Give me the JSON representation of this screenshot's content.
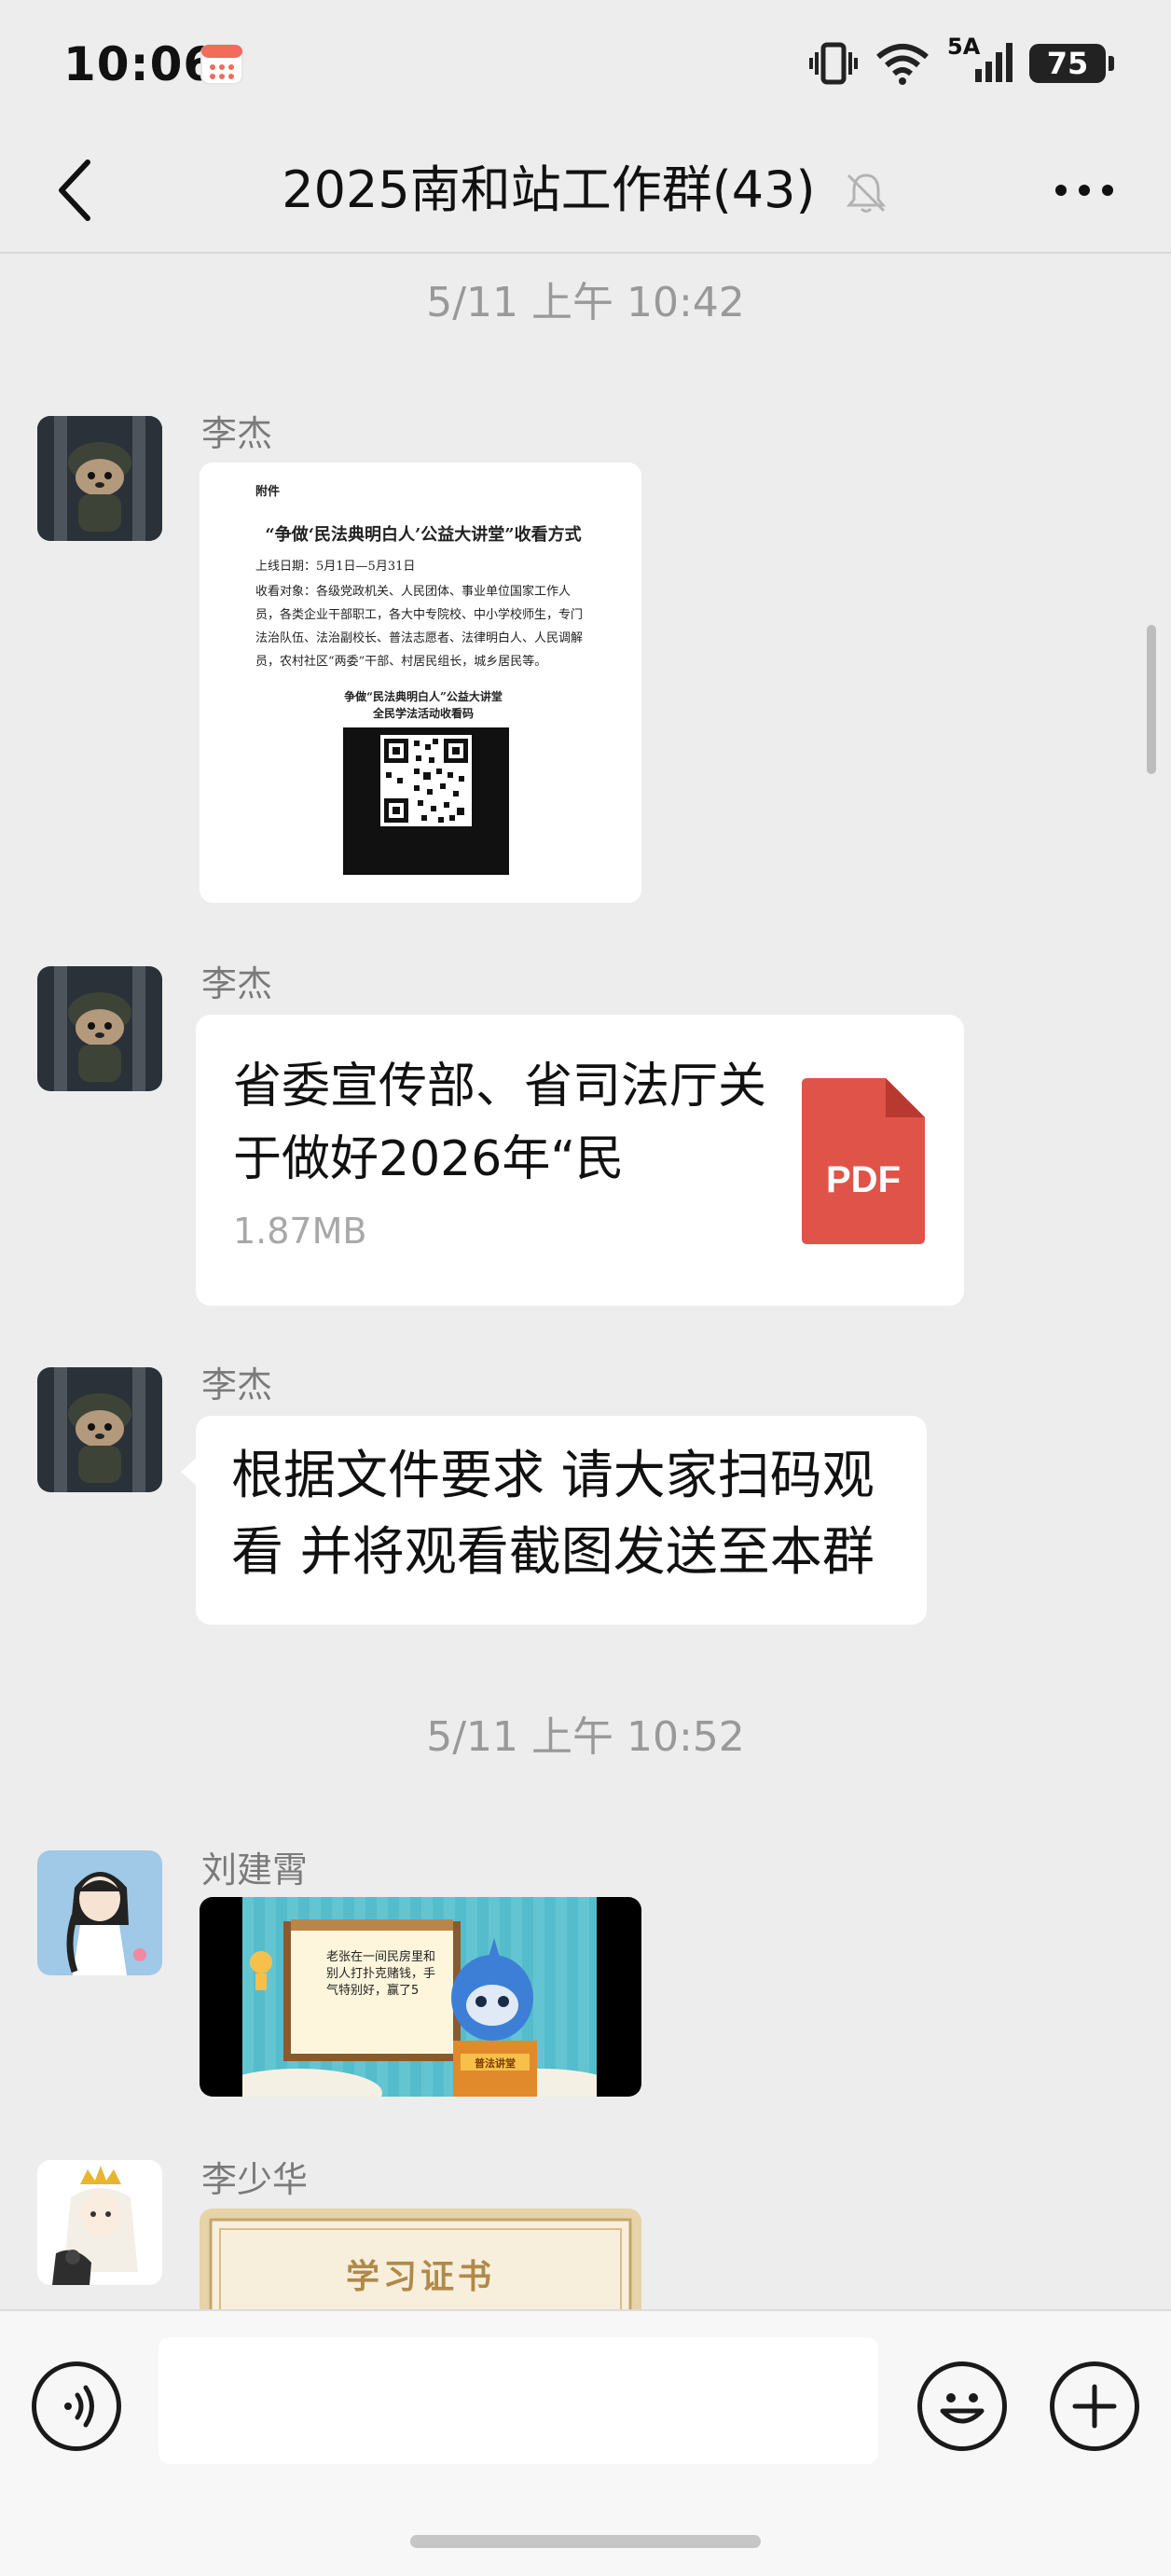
{
  "status_bar": {
    "time": "10:06",
    "network": "5A",
    "battery": "75"
  },
  "header": {
    "title": "2025南和站工作群(43)"
  },
  "messages": [
    {
      "type": "timestamp",
      "text": "5/11 上午 10:42"
    },
    {
      "type": "image",
      "sender": "李杰",
      "doc": {
        "label": "附件",
        "title": "“争做‘民法典明白人’公益大讲堂”收看方式",
        "date_line": "上线日期：5月1日—5月31日",
        "audience": "收看对象：各级党政机关、人民团体、事业单位国家工作人员，各类企业干部职工，各大中专院校、中小学校师生，专门法治队伍、法治副校长、普法志愿者、法律明白人、人民调解员，农村社区“两委”干部、村居民组长，城乡居民等。",
        "qr_caption_1": "争做“民法典明白人”公益大讲堂",
        "qr_caption_2": "全民学法活动收看码"
      }
    },
    {
      "type": "file",
      "sender": "李杰",
      "file_name": "省委宣传部、省司法厅关于做好2026年“民",
      "file_size": "1.87MB",
      "file_type": "PDF"
    },
    {
      "type": "text",
      "sender": "李杰",
      "text": "根据文件要求 请大家扫码观看 并将观看截图发送至本群"
    },
    {
      "type": "timestamp",
      "text": "5/11 上午 10:52"
    },
    {
      "type": "video",
      "sender": "刘建霄",
      "board_text": "老张在一间民房里和别人打扑克赌钱，手气特别好，赢了5",
      "podium_text": "普法讲堂"
    },
    {
      "type": "image",
      "sender": "李少华",
      "cert_text": "学习证书"
    }
  ],
  "colors": {
    "background": "#ededed",
    "bubble": "#ffffff",
    "pdf_red": "#e05348",
    "timestamp": "#999999"
  },
  "icons": [
    "back-icon",
    "mute-bell-icon",
    "more-icon",
    "voice-icon",
    "emoji-icon",
    "plus-icon",
    "pdf-icon"
  ]
}
